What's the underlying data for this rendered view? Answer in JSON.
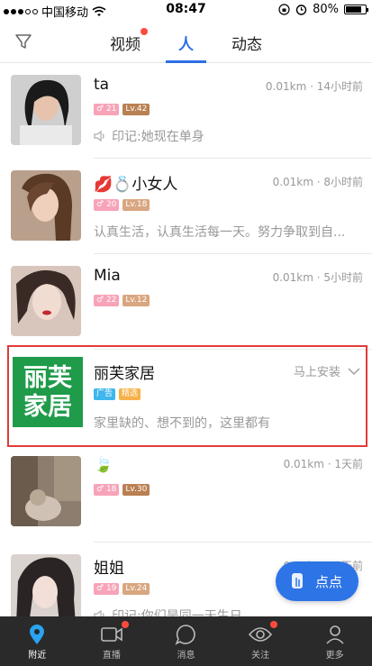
{
  "status": {
    "carrier": "中国移动",
    "time": "08:47",
    "battery": "80%",
    "battery_level": 0.8
  },
  "tabs": [
    {
      "label": "视频",
      "badge": true
    },
    {
      "label": "人",
      "active": true
    },
    {
      "label": "动态"
    }
  ],
  "rows": [
    {
      "name": "ta",
      "meta": "0.01km · 14小时前",
      "tag1": "21",
      "tag2": "Lv.42",
      "sub": "印记:她现在单身",
      "speaker": true
    },
    {
      "name": "💋💍小女人",
      "meta": "0.01km · 8小时前",
      "tag1": "20",
      "tag2": "Lv.18",
      "sub": "认真生活，认真生活每一天。努力争取到自..."
    },
    {
      "name": "Mia",
      "meta": "0.01km · 5小时前",
      "tag1": "22",
      "tag2": "Lv.12",
      "sub": ""
    },
    {
      "name": "🍃",
      "meta": "0.01km · 1天前",
      "tag1": "18",
      "tag2": "Lv.30",
      "sub": ""
    },
    {
      "name": "姐姐",
      "meta": "0.05km · 2天前",
      "tag1": "19",
      "tag2": "Lv.24",
      "sub": "印记:你们是同一天生日",
      "speaker": true
    }
  ],
  "ad": {
    "name": "丽芙家居",
    "logo_text": "丽芙家居",
    "action": "马上安装",
    "tag1": "广告",
    "tag2": "精选",
    "sub": "家里缺的、想不到的，这里都有"
  },
  "fab": {
    "label": "点点"
  },
  "bottom": [
    {
      "label": "附近",
      "active": true
    },
    {
      "label": "直播",
      "badge": true
    },
    {
      "label": "消息"
    },
    {
      "label": "关注",
      "badge": true
    },
    {
      "label": "更多"
    }
  ]
}
